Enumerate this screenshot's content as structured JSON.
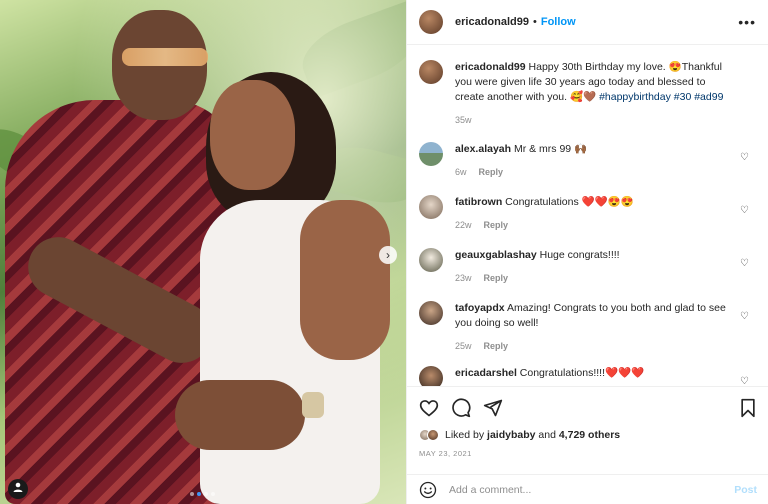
{
  "photo": {
    "carousel_next_glyph": "›",
    "dots": 4,
    "active_dot": 1
  },
  "header": {
    "username": "ericadonald99",
    "separator": "•",
    "follow_label": "Follow",
    "more_glyph": "•••"
  },
  "caption": {
    "user": "ericadonald99",
    "text": "Happy 30th Birthday my love. 😍Thankful you were given life 30 years ago today and blessed to create another with you. 🥰🤎",
    "hashtags": "#happybirthday #30 #ad99",
    "time": "35w"
  },
  "comments": [
    {
      "user": "alex.alayah",
      "text": "Mr & mrs 99 🙌🏾",
      "time": "6w",
      "reply": "Reply"
    },
    {
      "user": "fatibrown",
      "text": "Congratulations ❤️❤️😍😍",
      "time": "22w",
      "reply": "Reply"
    },
    {
      "user": "geauxgablashay",
      "text": "Huge congrats!!!!",
      "time": "23w",
      "reply": "Reply"
    },
    {
      "user": "tafoyapdx",
      "text": "Amazing! Congrats to you both and glad to see you doing so well!",
      "time": "25w",
      "reply": "Reply"
    },
    {
      "user": "ericadarshel",
      "text": "Congratulations!!!!❤️❤️❤️",
      "time": "",
      "reply": ""
    }
  ],
  "likes": {
    "prefix": "Liked by",
    "user": "jaidybaby",
    "joiner": "and",
    "count": "4,729 others"
  },
  "date": "MAY 23, 2021",
  "add_comment": {
    "placeholder": "Add a comment...",
    "post_label": "Post"
  },
  "colors": {
    "accent": "#0095f6",
    "post_disabled": "#b2dffc",
    "secondary_text": "#8e8e8e"
  },
  "icons": [
    "heart-icon",
    "comment-icon",
    "share-icon",
    "bookmark-icon",
    "smiley-icon",
    "more-icon",
    "tag-person-icon"
  ]
}
